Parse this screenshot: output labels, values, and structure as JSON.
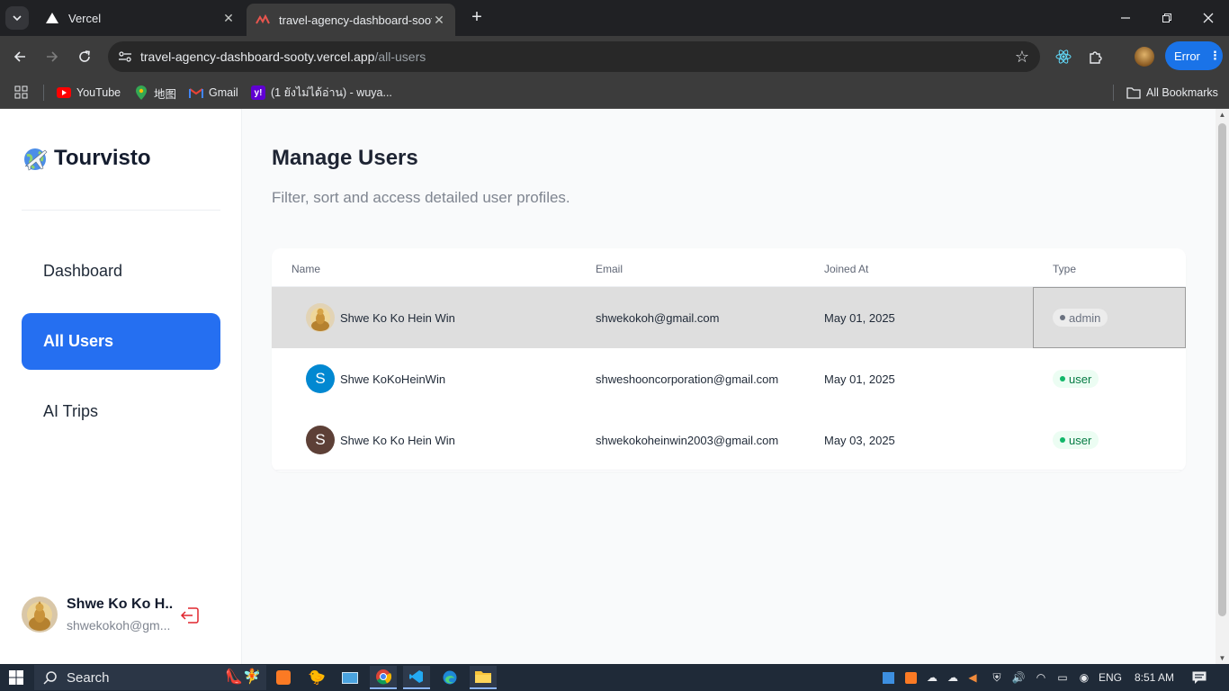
{
  "browser": {
    "tabs": [
      {
        "title": "Vercel",
        "active": false
      },
      {
        "title": "travel-agency-dashboard-sooty",
        "active": true
      }
    ],
    "url_host": "travel-agency-dashboard-sooty.vercel.app",
    "url_path": "/all-users",
    "error_label": "Error",
    "bookmarks": [
      {
        "label": "YouTube",
        "icon": "youtube-icon"
      },
      {
        "label": "地图",
        "icon": "maps-icon"
      },
      {
        "label": "Gmail",
        "icon": "gmail-icon"
      },
      {
        "label": "(1 ยังไม่ได้อ่าน) - wuya...",
        "icon": "yahoo-icon"
      }
    ],
    "all_bookmarks_label": "All Bookmarks"
  },
  "sidebar": {
    "brand": "Tourvisto",
    "nav": [
      {
        "label": "Dashboard",
        "active": false
      },
      {
        "label": "All Users",
        "active": true
      },
      {
        "label": "AI Trips",
        "active": false
      }
    ],
    "user": {
      "name": "Shwe Ko Ko H...",
      "email": "shwekokoh@gm..."
    }
  },
  "main": {
    "title": "Manage Users",
    "subtitle": "Filter, sort and access detailed user profiles."
  },
  "table": {
    "columns": [
      "Name",
      "Email",
      "Joined At",
      "Type"
    ],
    "rows": [
      {
        "name": "Shwe Ko Ko Hein Win",
        "email": "shwekokoh@gmail.com",
        "joined": "May 01, 2025",
        "type": "admin",
        "avatar": "photo",
        "avatar_color": ""
      },
      {
        "name": "Shwe KoKoHeinWin",
        "email": "shweshooncorporation@gmail.com",
        "joined": "May 01, 2025",
        "type": "user",
        "avatar": "S",
        "avatar_color": "#0288d1"
      },
      {
        "name": "Shwe Ko Ko Hein Win",
        "email": "shwekokoheinwin2003@gmail.com",
        "joined": "May 03, 2025",
        "type": "user",
        "avatar": "S",
        "avatar_color": "#5d4037"
      }
    ]
  },
  "taskbar": {
    "search_label": "Search",
    "lang": "ENG",
    "time": "8:51 AM"
  },
  "colors": {
    "accent": "#256ff1",
    "user_badge": "#ecfdf3",
    "admin_badge": "#ececec"
  }
}
